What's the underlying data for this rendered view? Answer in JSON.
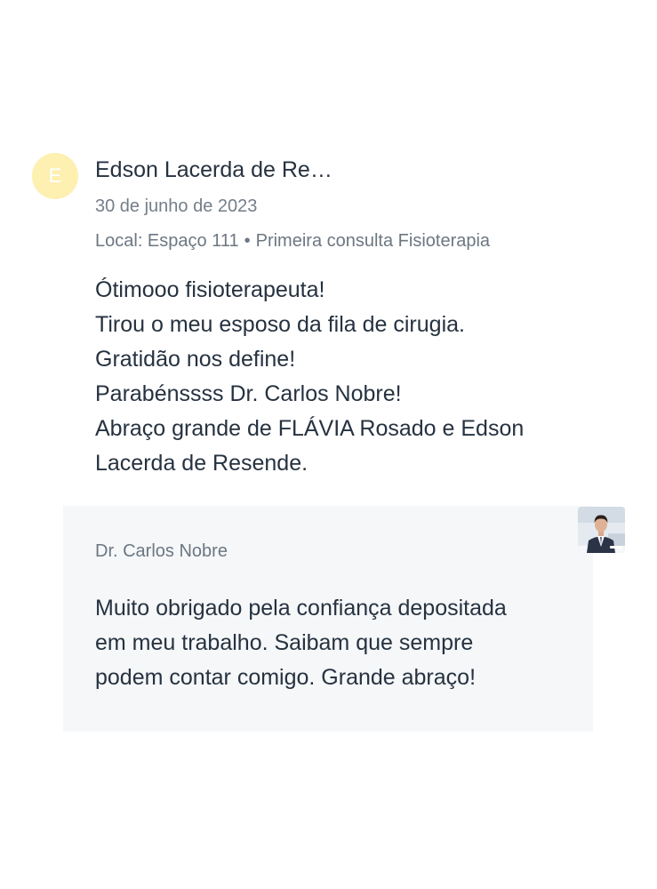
{
  "review": {
    "avatar_letter": "E",
    "author": "Edson Lacerda de Re…",
    "date": "30 de junho de 2023",
    "location": "Local: Espaço 111",
    "separator": "•",
    "visit_type": "Primeira consulta Fisioterapia",
    "text_lines": [
      "Ótimooo fisioterapeuta!",
      "Tirou o meu esposo da fila de cirugia.",
      "Gratidão nos define!",
      "Parabénssss Dr. Carlos Nobre!",
      "Abraço grande de FLÁVIA Rosado e Edson",
      "Lacerda de Resende."
    ]
  },
  "reply": {
    "name": "Dr. Carlos Nobre",
    "photo_icon": "doctor-photo",
    "text_lines": [
      "Muito obrigado pela confiança depositada",
      "em meu trabalho. Saibam que sempre",
      "podem contar comigo. Grande abraço!"
    ]
  },
  "colors": {
    "avatar_bg": "#fdf0b0",
    "text": "#263240",
    "muted": "#6c7782",
    "reply_bg": "#f5f7f9"
  }
}
